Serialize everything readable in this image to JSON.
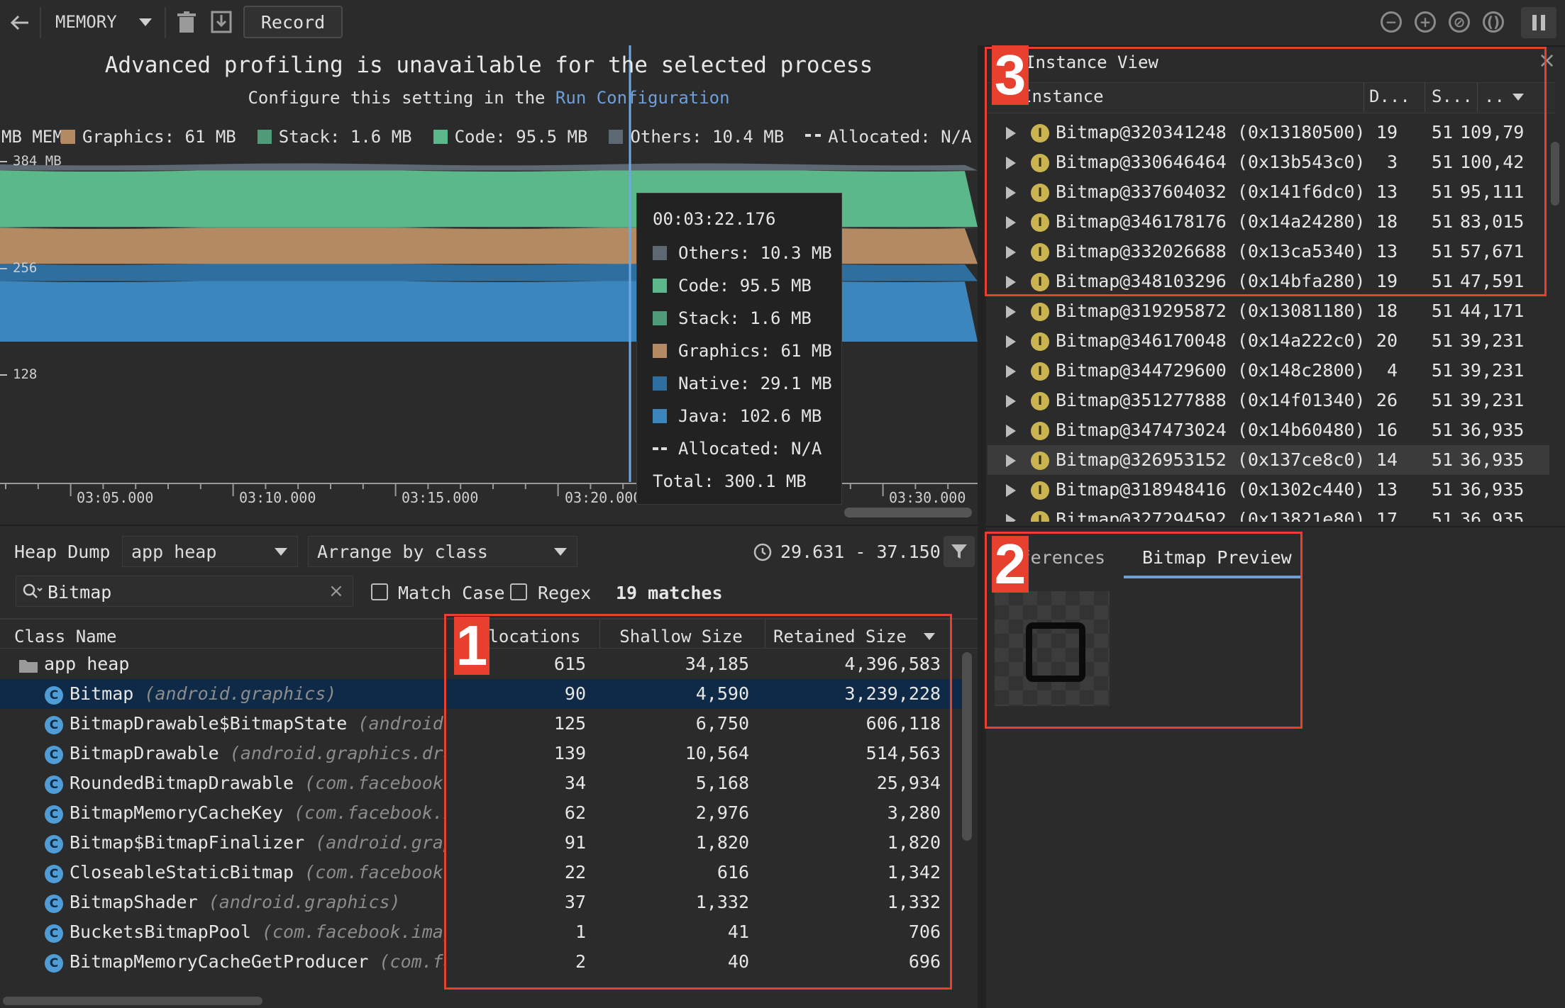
{
  "toolbar": {
    "profiler_name": "MEMORY",
    "record_label": "Record"
  },
  "chart": {
    "title": "Advanced profiling is unavailable for the selected process",
    "subtitle_prefix": "Configure this setting in the",
    "subtitle_link": "Run Configuration",
    "legend": [
      {
        "label": "Graphics: 61 MB",
        "color": "#b48a62"
      },
      {
        "label": "Stack: 1.6 MB",
        "color": "#4f9b79"
      },
      {
        "label": "Code: 95.5 MB",
        "color": "#5bb88a"
      },
      {
        "label": "Others: 10.4 MB",
        "color": "#5e6873"
      },
      {
        "label": "Allocated: N/A",
        "color": "#dddddd"
      }
    ],
    "legend_prefix": "MB MEMORY",
    "tooltip": {
      "time": "00:03:22.176",
      "rows": [
        {
          "label": "Others: 10.3 MB",
          "color": "#5e6873"
        },
        {
          "label": "Code: 95.5 MB",
          "color": "#5bb88a"
        },
        {
          "label": "Stack: 1.6 MB",
          "color": "#4f9b79"
        },
        {
          "label": "Graphics: 61 MB",
          "color": "#b48a62"
        },
        {
          "label": "Native: 29.1 MB",
          "color": "#2f6f9f"
        },
        {
          "label": "Java: 102.6 MB",
          "color": "#3a86bd"
        },
        {
          "label": "Allocated: N/A",
          "color": "#dddddd"
        }
      ],
      "total": "Total: 300.1 MB"
    }
  },
  "chart_data": {
    "type": "area",
    "title": "",
    "ylabel": "MB",
    "y_ticks": [
      "384 MB",
      "256",
      "128"
    ],
    "x_ticks": [
      "03:05.000",
      "03:10.000",
      "03:15.000",
      "03:20.000",
      "03:30.000"
    ],
    "ylim": [
      0,
      384
    ],
    "series": [
      {
        "name": "Java",
        "values": [
          102.6
        ]
      },
      {
        "name": "Native",
        "values": [
          29.1
        ]
      },
      {
        "name": "Graphics",
        "values": [
          61
        ]
      },
      {
        "name": "Stack",
        "values": [
          1.6
        ]
      },
      {
        "name": "Code",
        "values": [
          95.5
        ]
      },
      {
        "name": "Others",
        "values": [
          10.3
        ]
      }
    ]
  },
  "heap": {
    "label": "Heap Dump",
    "heap_select": "app heap",
    "arrange_select": "Arrange by class",
    "time_range": "29.631 - 37.150",
    "search_value": "Bitmap",
    "match_case": "Match Case",
    "regex": "Regex",
    "matches": "19 matches",
    "columns": [
      "Class Name",
      "Allocations",
      "Shallow Size",
      "Retained Size"
    ],
    "root": {
      "name": "app heap",
      "alloc": "615",
      "shallow": "34,185",
      "retained": "4,396,583"
    },
    "rows": [
      {
        "name": "Bitmap",
        "pkg": "(android.graphics)",
        "alloc": "90",
        "shallow": "4,590",
        "retained": "3,239,228"
      },
      {
        "name": "BitmapDrawable$BitmapState",
        "pkg": "(android.gr",
        "alloc": "125",
        "shallow": "6,750",
        "retained": "606,118"
      },
      {
        "name": "BitmapDrawable",
        "pkg": "(android.graphics.drawa",
        "alloc": "139",
        "shallow": "10,564",
        "retained": "514,563"
      },
      {
        "name": "RoundedBitmapDrawable",
        "pkg": "(com.facebook.dr",
        "alloc": "34",
        "shallow": "5,168",
        "retained": "25,934"
      },
      {
        "name": "BitmapMemoryCacheKey",
        "pkg": "(com.facebook.ima",
        "alloc": "62",
        "shallow": "2,976",
        "retained": "3,280"
      },
      {
        "name": "Bitmap$BitmapFinalizer",
        "pkg": "(android.graphi",
        "alloc": "91",
        "shallow": "1,820",
        "retained": "1,820"
      },
      {
        "name": "CloseableStaticBitmap",
        "pkg": "(com.facebook.im",
        "alloc": "22",
        "shallow": "616",
        "retained": "1,342"
      },
      {
        "name": "BitmapShader",
        "pkg": "(android.graphics)",
        "alloc": "37",
        "shallow": "1,332",
        "retained": "1,332"
      },
      {
        "name": "BucketsBitmapPool",
        "pkg": "(com.facebook.imagep",
        "alloc": "1",
        "shallow": "41",
        "retained": "706"
      },
      {
        "name": "BitmapMemoryCacheGetProducer",
        "pkg": "(com.face",
        "alloc": "2",
        "shallow": "40",
        "retained": "696"
      }
    ]
  },
  "instance_view": {
    "title": "Instance View",
    "columns": [
      "Instance",
      "D...",
      "S...",
      ".."
    ],
    "rows": [
      {
        "name": "Bitmap@320341248 (0x13180500)",
        "d": "19",
        "s": "51",
        "r": "109,79"
      },
      {
        "name": "Bitmap@330646464 (0x13b543c0)",
        "d": "3",
        "s": "51",
        "r": "100,42"
      },
      {
        "name": "Bitmap@337604032 (0x141f6dc0)",
        "d": "13",
        "s": "51",
        "r": "95,111"
      },
      {
        "name": "Bitmap@346178176 (0x14a24280)",
        "d": "18",
        "s": "51",
        "r": "83,015"
      },
      {
        "name": "Bitmap@332026688 (0x13ca5340)",
        "d": "13",
        "s": "51",
        "r": "57,671"
      },
      {
        "name": "Bitmap@348103296 (0x14bfa280)",
        "d": "19",
        "s": "51",
        "r": "47,591"
      },
      {
        "name": "Bitmap@319295872 (0x13081180)",
        "d": "18",
        "s": "51",
        "r": "44,171"
      },
      {
        "name": "Bitmap@346170048 (0x14a222c0)",
        "d": "20",
        "s": "51",
        "r": "39,231"
      },
      {
        "name": "Bitmap@344729600 (0x148c2800)",
        "d": "4",
        "s": "51",
        "r": "39,231"
      },
      {
        "name": "Bitmap@351277888 (0x14f01340)",
        "d": "26",
        "s": "51",
        "r": "39,231"
      },
      {
        "name": "Bitmap@347473024 (0x14b60480)",
        "d": "16",
        "s": "51",
        "r": "36,935"
      },
      {
        "name": "Bitmap@326953152 (0x137ce8c0)",
        "d": "14",
        "s": "51",
        "r": "36,935"
      },
      {
        "name": "Bitmap@318948416 (0x1302c440)",
        "d": "13",
        "s": "51",
        "r": "36,935"
      },
      {
        "name": "Bitmap@327294592 (0x13821e80)",
        "d": "17",
        "s": "51",
        "r": "36,935"
      }
    ],
    "tabs": [
      "References",
      "Bitmap Preview"
    ]
  },
  "annotations": [
    "1",
    "2",
    "3"
  ]
}
